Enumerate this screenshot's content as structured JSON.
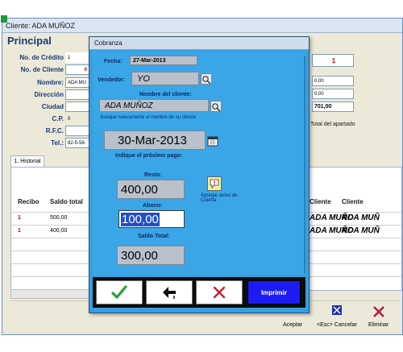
{
  "background_window": {
    "title": "Cliente: ADA MUÑOZ",
    "heading": "Principal",
    "fields": {
      "no_credito_label": "No. de Crédito",
      "no_credito_value": "1",
      "no_cliente_label": "No. de Cliente",
      "no_cliente_value": "0",
      "nombre_label": "Nombre:",
      "nombre_value": "ADA MU",
      "direccion_label": "Dirección",
      "ciudad_label": "Ciudad",
      "cp_label": "C.P.",
      "cp_value": "0",
      "rfc_label": "R.F.C.",
      "tel_label": "Tel.:",
      "tel_value": "82-5-56-"
    },
    "right_column": {
      "code_value": "1",
      "amount1": "0,00",
      "amount2": "0,00",
      "total_value": "701,00",
      "total_note": "Total del apartado"
    },
    "tab": "1. Historial",
    "grid": {
      "headers": [
        "Recibo",
        "Saldo total",
        "Cliente",
        "Cliente"
      ],
      "rows": [
        {
          "recibo": "1",
          "saldo": "500,00",
          "cliente": "ADA MUÑO",
          "cliente2": "ADA MUÑ"
        },
        {
          "recibo": "1",
          "saldo": "400,00",
          "cliente": "ADA MUÑO",
          "cliente2": "ADA MUÑ"
        }
      ]
    },
    "bottom_buttons": {
      "aceptar": "Aceptar",
      "cancelar": "<Esc> Cancelar",
      "eliminar": "Eliminar"
    }
  },
  "dialog": {
    "title": "Cobranza",
    "fecha_label": "Fecha:",
    "fecha_value": "27-Mar-2013",
    "vendedor_label": "Vendedor:",
    "vendedor_value": "YO",
    "nombre_cliente_label": "Nombre del cliente:",
    "nombre_cliente_value": "ADA MUÑOZ",
    "busque_hint": "busque nuevamente el nombre de su cliente",
    "proximo_pago_date": "30-Mar-2013",
    "proximo_pago_label": "Indique el próximo pago:",
    "resto_label": "Resto:",
    "resto_value": "400,00",
    "abono_label": "Abono:",
    "abono_value": "100,00",
    "saldo_total_label": "Saldo Total:",
    "saldo_total_value": "300,00",
    "agregar_aviso": "Agregar aviso de Cuenta",
    "imprimir_label": "Imprimir"
  },
  "colors": {
    "dialog_blue": "#379fe0",
    "label_navy": "#0b2a66",
    "field_gray": "#b9c2cc",
    "accept_green": "#22a23a",
    "cancel_red": "#c42030",
    "print_blue": "#1c1cf2"
  }
}
